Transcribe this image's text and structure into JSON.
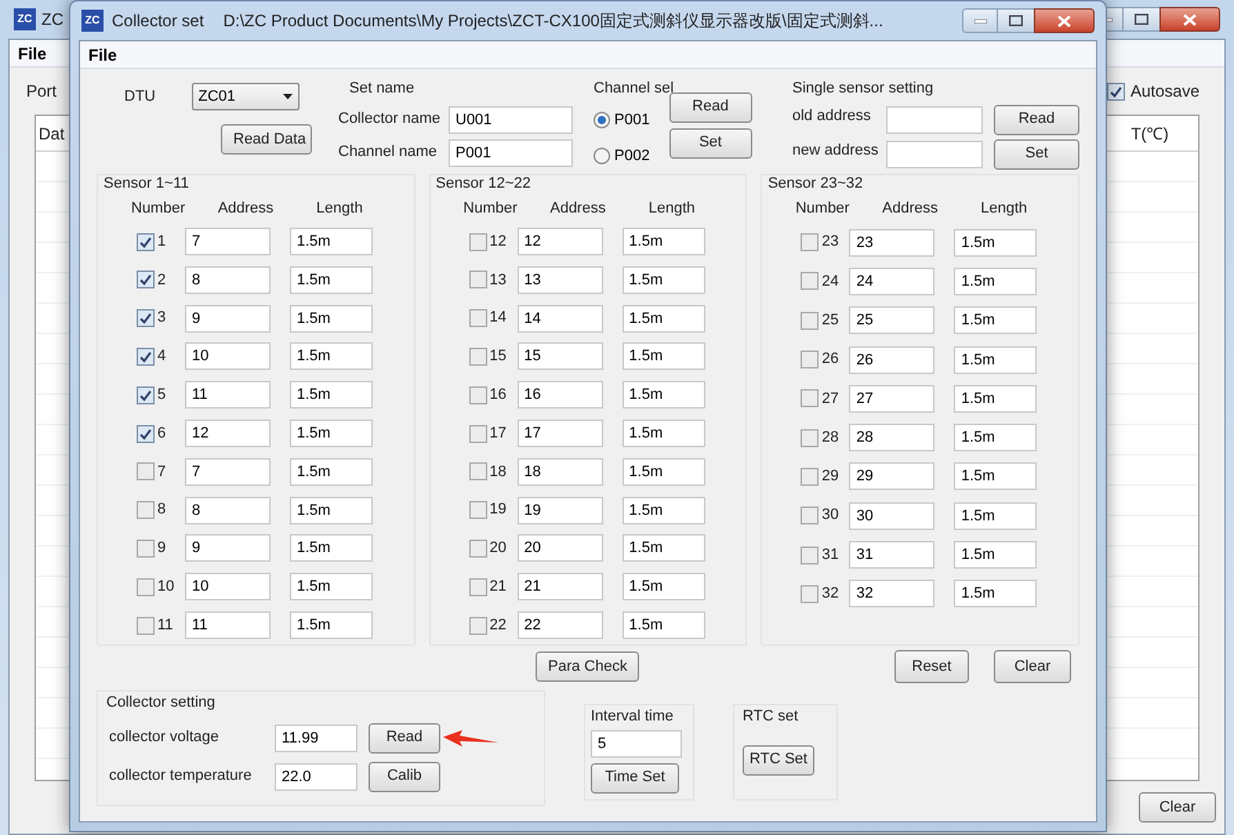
{
  "background_window": {
    "icon_text": "ZC",
    "title": "ZC",
    "menu": [
      "File"
    ],
    "port_label": "Port",
    "autosave": {
      "label": "Autosave",
      "checked": true
    },
    "table": {
      "columns": [
        "Dat",
        "T(℃)"
      ]
    },
    "clear_button": "Clear"
  },
  "dialog": {
    "icon_text": "ZC",
    "title": "Collector set",
    "path": "D:\\ZC Product Documents\\My Projects\\ZCT-CX100固定式测斜仪显示器改版\\固定式测斜...",
    "menu": [
      "File"
    ],
    "dtu": {
      "label": "DTU",
      "value": "ZC01",
      "button": "Read Data"
    },
    "set_name": {
      "title": "Set name",
      "fields": [
        {
          "label": "Collector name",
          "value": "U001"
        },
        {
          "label": "Channel name",
          "value": "P001"
        }
      ]
    },
    "channel_sel": {
      "title": "Channel sel",
      "options": [
        {
          "label": "P001",
          "selected": true
        },
        {
          "label": "P002",
          "selected": false
        }
      ],
      "buttons": [
        "Read",
        "Set"
      ]
    },
    "single_sensor": {
      "title": "Single sensor setting",
      "rows": [
        {
          "label": "old address",
          "button": "Read"
        },
        {
          "label": "new address",
          "button": "Set"
        }
      ]
    },
    "sensor_groups": [
      {
        "title": "Sensor 1~11",
        "columns": [
          "Number",
          "Address",
          "Length"
        ],
        "rows": [
          {
            "number": "1",
            "checked": true,
            "address": "7",
            "length": "1.5m"
          },
          {
            "number": "2",
            "checked": true,
            "address": "8",
            "length": "1.5m"
          },
          {
            "number": "3",
            "checked": true,
            "address": "9",
            "length": "1.5m"
          },
          {
            "number": "4",
            "checked": true,
            "address": "10",
            "length": "1.5m"
          },
          {
            "number": "5",
            "checked": true,
            "address": "11",
            "length": "1.5m"
          },
          {
            "number": "6",
            "checked": true,
            "address": "12",
            "length": "1.5m"
          },
          {
            "number": "7",
            "checked": false,
            "address": "7",
            "length": "1.5m"
          },
          {
            "number": "8",
            "checked": false,
            "address": "8",
            "length": "1.5m"
          },
          {
            "number": "9",
            "checked": false,
            "address": "9",
            "length": "1.5m"
          },
          {
            "number": "10",
            "checked": false,
            "address": "10",
            "length": "1.5m"
          },
          {
            "number": "11",
            "checked": false,
            "address": "11",
            "length": "1.5m"
          }
        ]
      },
      {
        "title": "Sensor 12~22",
        "columns": [
          "Number",
          "Address",
          "Length"
        ],
        "rows": [
          {
            "number": "12",
            "checked": false,
            "address": "12",
            "length": "1.5m"
          },
          {
            "number": "13",
            "checked": false,
            "address": "13",
            "length": "1.5m"
          },
          {
            "number": "14",
            "checked": false,
            "address": "14",
            "length": "1.5m"
          },
          {
            "number": "15",
            "checked": false,
            "address": "15",
            "length": "1.5m"
          },
          {
            "number": "16",
            "checked": false,
            "address": "16",
            "length": "1.5m"
          },
          {
            "number": "17",
            "checked": false,
            "address": "17",
            "length": "1.5m"
          },
          {
            "number": "18",
            "checked": false,
            "address": "18",
            "length": "1.5m"
          },
          {
            "number": "19",
            "checked": false,
            "address": "19",
            "length": "1.5m"
          },
          {
            "number": "20",
            "checked": false,
            "address": "20",
            "length": "1.5m"
          },
          {
            "number": "21",
            "checked": false,
            "address": "21",
            "length": "1.5m"
          },
          {
            "number": "22",
            "checked": false,
            "address": "22",
            "length": "1.5m"
          }
        ]
      },
      {
        "title": "Sensor 23~32",
        "columns": [
          "Number",
          "Address",
          "Length"
        ],
        "rows": [
          {
            "number": "23",
            "checked": false,
            "address": "23",
            "length": "1.5m"
          },
          {
            "number": "24",
            "checked": false,
            "address": "24",
            "length": "1.5m"
          },
          {
            "number": "25",
            "checked": false,
            "address": "25",
            "length": "1.5m"
          },
          {
            "number": "26",
            "checked": false,
            "address": "26",
            "length": "1.5m"
          },
          {
            "number": "27",
            "checked": false,
            "address": "27",
            "length": "1.5m"
          },
          {
            "number": "28",
            "checked": false,
            "address": "28",
            "length": "1.5m"
          },
          {
            "number": "29",
            "checked": false,
            "address": "29",
            "length": "1.5m"
          },
          {
            "number": "30",
            "checked": false,
            "address": "30",
            "length": "1.5m"
          },
          {
            "number": "31",
            "checked": false,
            "address": "31",
            "length": "1.5m"
          },
          {
            "number": "32",
            "checked": false,
            "address": "32",
            "length": "1.5m"
          }
        ]
      }
    ],
    "para_check_button": "Para Check",
    "reset_button": "Reset",
    "clear_button": "Clear",
    "collector_setting": {
      "title": "Collector setting",
      "rows": [
        {
          "label": "collector voltage",
          "value": "11.99",
          "button": "Read"
        },
        {
          "label": "collector temperature",
          "value": "22.0",
          "button": "Calib"
        }
      ]
    },
    "interval_time": {
      "title": "Interval time",
      "value": "5",
      "button": "Time Set"
    },
    "rtc_set": {
      "title": "RTC set",
      "button": "RTC Set"
    }
  }
}
